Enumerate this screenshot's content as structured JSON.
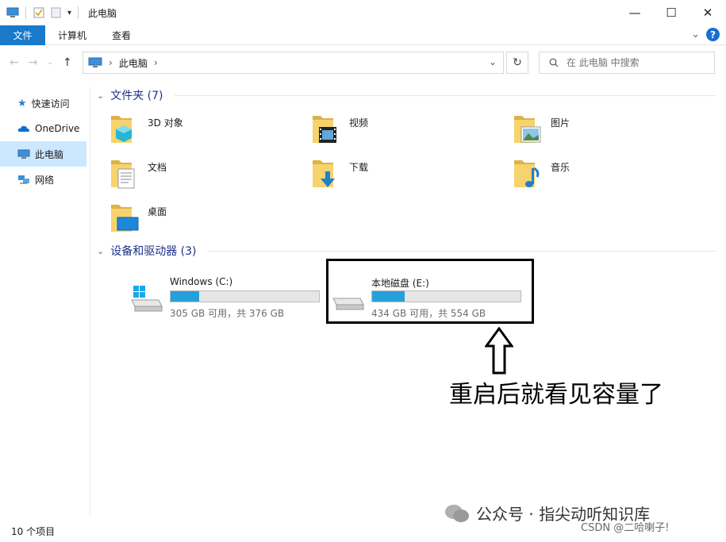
{
  "window": {
    "title": "此电脑",
    "minimize": "—",
    "maximize": "☐",
    "close": "✕"
  },
  "ribbon": {
    "tabs": [
      "文件",
      "计算机",
      "查看"
    ],
    "collapse": "⌄",
    "help": "?"
  },
  "address": {
    "path_segment": "此电脑",
    "search_placeholder": "在 此电脑 中搜索"
  },
  "nav_pane": {
    "items": [
      {
        "label": "快速访问",
        "icon": "star-icon",
        "selected": false
      },
      {
        "label": "OneDrive",
        "icon": "cloud-icon",
        "selected": false
      },
      {
        "label": "此电脑",
        "icon": "computer-icon",
        "selected": true
      },
      {
        "label": "网络",
        "icon": "network-icon",
        "selected": false
      }
    ]
  },
  "folders_group": {
    "title": "文件夹 (7)",
    "items": [
      {
        "label": "3D 对象",
        "icon": "3d-objects-folder-icon"
      },
      {
        "label": "视频",
        "icon": "videos-folder-icon"
      },
      {
        "label": "图片",
        "icon": "pictures-folder-icon"
      },
      {
        "label": "文档",
        "icon": "documents-folder-icon"
      },
      {
        "label": "下载",
        "icon": "downloads-folder-icon"
      },
      {
        "label": "音乐",
        "icon": "music-folder-icon"
      },
      {
        "label": "桌面",
        "icon": "desktop-folder-icon"
      }
    ]
  },
  "drives_group": {
    "title": "设备和驱动器 (3)",
    "items": [
      {
        "label": "Windows (C:)",
        "space": "305 GB 可用，共 376 GB",
        "used_fraction": 0.19,
        "icon": "windows-drive-icon"
      },
      {
        "label": "本地磁盘 (E:)",
        "space": "434 GB 可用，共 554 GB",
        "used_fraction": 0.22,
        "icon": "local-disk-icon"
      }
    ]
  },
  "annotation": {
    "text": "重启后就看见容量了"
  },
  "status_bar": {
    "item_count": "10 个项目"
  },
  "watermarks": {
    "wechat": "公众号 · 指尖动听知识库",
    "csdn": "CSDN @二哈喇子!"
  },
  "colors": {
    "accent": "#1979ca",
    "progress": "#26a0da",
    "selected_nav": "#cce8ff",
    "group_header": "#1e3287"
  }
}
